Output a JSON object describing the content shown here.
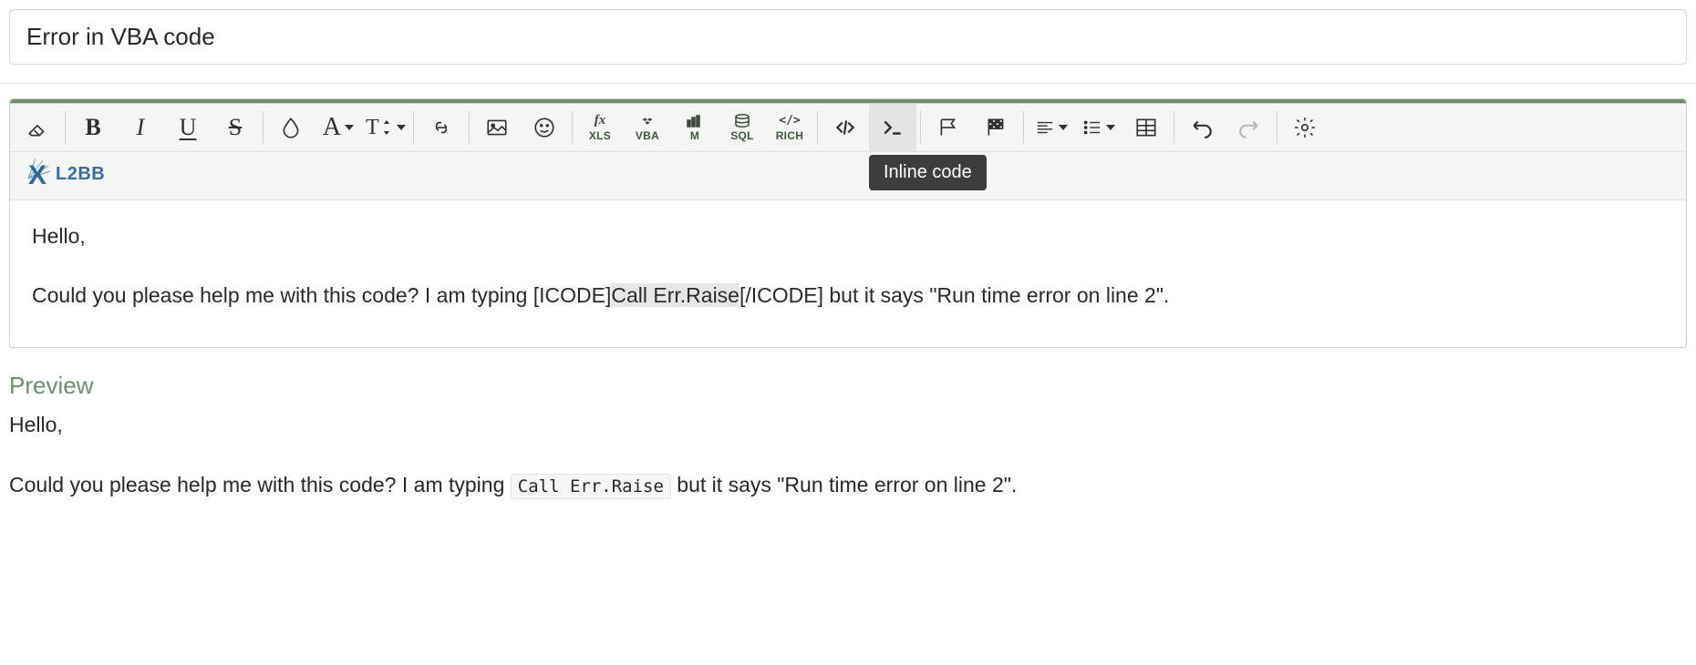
{
  "title": "Error in VBA code",
  "tooltip": "Inline code",
  "toolbar": {
    "labels": {
      "xls": "XLS",
      "vba": "VBA",
      "m": "M",
      "sql": "SQL",
      "rich": "RICH"
    },
    "xl2bb": "L2BB"
  },
  "editor": {
    "p1": "Hello,",
    "p2_a": "Could you please help me with this code? I am typing [ICODE]",
    "p2_sel": "Call Err.Raise",
    "p2_b": "[/ICODE] but it says \"Run time error on line 2\"."
  },
  "preview": {
    "label": "Preview",
    "p1": "Hello,",
    "p2_a": "Could you please help me with this code? I am typing ",
    "p2_code": "Call Err.Raise",
    "p2_b": " but it says \"Run time error on line 2\"."
  }
}
